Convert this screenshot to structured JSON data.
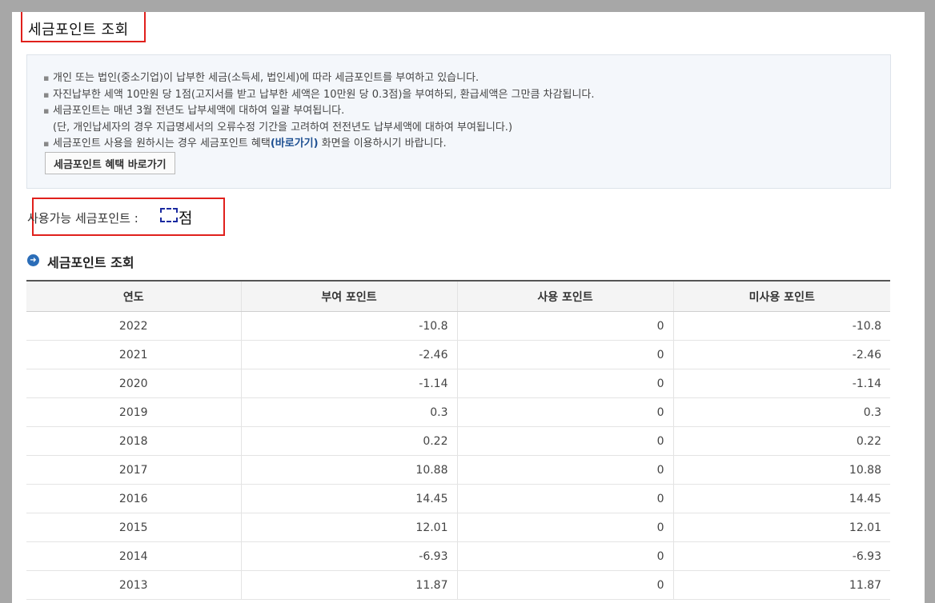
{
  "page": {
    "title": "세금포인트 조회"
  },
  "info": {
    "lines": [
      "개인 또는 법인(중소기업)이 납부한 세금(소득세, 법인세)에 따라 세금포인트를 부여하고 있습니다.",
      "자진납부한 세액 10만원 당 1점(고지서를 받고 납부한 세액은 10만원 당 0.3점)을 부여하되, 환급세액은 그만큼 차감됩니다.",
      "세금포인트는 매년 3월 전년도 납부세액에 대하여 일괄 부여됩니다."
    ],
    "sub_line": "(단, 개인납세자의 경우 지급명세서의 오류수정 기간을 고려하여 전전년도 납부세액에 대하여 부여됩니다.)",
    "last_line_pre": "세금포인트 사용을 원하시는 경우 세금포인트 혜택",
    "last_line_link": "(바로가기)",
    "last_line_post": " 화면을 이용하시기 바랍니다.",
    "button_label": "세금포인트 혜택 바로가기"
  },
  "available": {
    "label": "사용가능 세금포인트 :",
    "unit": "점"
  },
  "section": {
    "title": "세금포인트 조회"
  },
  "table": {
    "headers": [
      "연도",
      "부여 포인트",
      "사용 포인트",
      "미사용 포인트"
    ],
    "rows": [
      [
        "2022",
        "-10.8",
        "0",
        "-10.8"
      ],
      [
        "2021",
        "-2.46",
        "0",
        "-2.46"
      ],
      [
        "2020",
        "-1.14",
        "0",
        "-1.14"
      ],
      [
        "2019",
        "0.3",
        "0",
        "0.3"
      ],
      [
        "2018",
        "0.22",
        "0",
        "0.22"
      ],
      [
        "2017",
        "10.88",
        "0",
        "10.88"
      ],
      [
        "2016",
        "14.45",
        "0",
        "14.45"
      ],
      [
        "2015",
        "12.01",
        "0",
        "12.01"
      ],
      [
        "2014",
        "-6.93",
        "0",
        "-6.93"
      ],
      [
        "2013",
        "11.87",
        "0",
        "11.87"
      ]
    ]
  },
  "colors": {
    "highlight_border": "#e0201c",
    "link": "#1d4f91",
    "section_icon": "#2b6db8",
    "info_bg": "#f4f7fb"
  }
}
